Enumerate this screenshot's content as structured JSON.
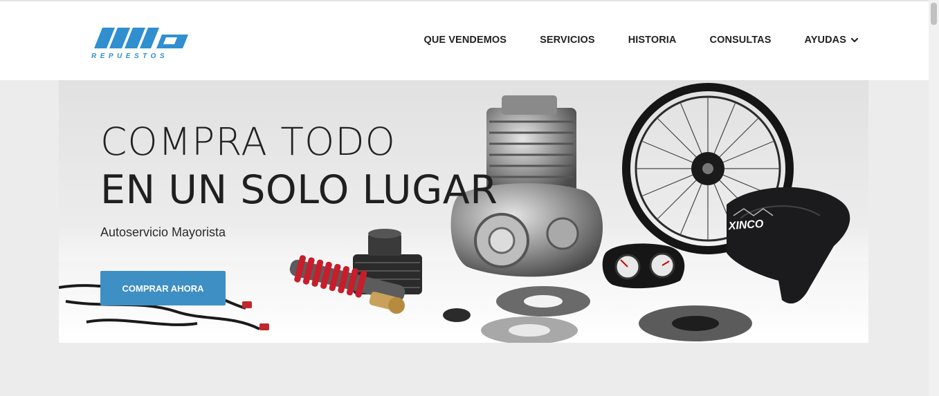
{
  "brand": {
    "logo_text": "REPUESTOS",
    "accent_color": "#2f8fcf"
  },
  "nav": {
    "items": [
      {
        "label": "QUE VENDEMOS"
      },
      {
        "label": "SERVICIOS"
      },
      {
        "label": "HISTORIA"
      },
      {
        "label": "CONSULTAS"
      },
      {
        "label": "AYUDAS",
        "icon": "chevron-down-icon"
      }
    ]
  },
  "hero": {
    "title_line1": "COMPRA TODO",
    "title_line2": "EN UN SOLO LUGAR",
    "subtitle": "Autoservicio Mayorista",
    "cta_label": "COMPRAR AHORA",
    "cta_color": "#3e8fc4",
    "seat_brand": "XINCO"
  }
}
